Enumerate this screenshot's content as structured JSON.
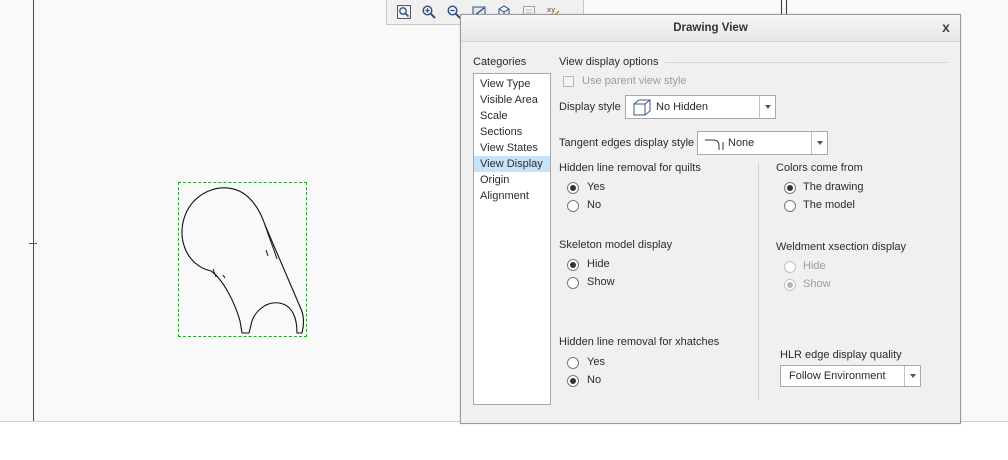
{
  "toolbar": {
    "icons": [
      "zoom-window-icon",
      "zoom-in-icon",
      "zoom-out-icon",
      "repaint-icon",
      "display-style-icon",
      "sheet-icon",
      "snap-icon"
    ]
  },
  "dialog": {
    "title": "Drawing View",
    "close_label": "x",
    "categories_label": "Categories",
    "categories": [
      {
        "label": "View Type",
        "selected": false
      },
      {
        "label": "Visible Area",
        "selected": false
      },
      {
        "label": "Scale",
        "selected": false
      },
      {
        "label": "Sections",
        "selected": false
      },
      {
        "label": "View States",
        "selected": false
      },
      {
        "label": "View Display",
        "selected": true
      },
      {
        "label": "Origin",
        "selected": false
      },
      {
        "label": "Alignment",
        "selected": false
      }
    ],
    "section_title": "View display options",
    "use_parent_label": "Use parent view style",
    "display_style_label": "Display style",
    "display_style_value": "No Hidden",
    "tangent_label": "Tangent edges display style",
    "tangent_value": "None",
    "hlr_quilts": {
      "label": "Hidden line removal for quilts",
      "yes": "Yes",
      "no": "No",
      "selected": "Yes"
    },
    "colors_from": {
      "label": "Colors come from",
      "drawing": "The drawing",
      "model": "The model",
      "selected": "The drawing"
    },
    "skeleton": {
      "label": "Skeleton model display",
      "hide": "Hide",
      "show": "Show",
      "selected": "Hide"
    },
    "weldment": {
      "label": "Weldment xsection display",
      "hide": "Hide",
      "show": "Show",
      "selected": "Show"
    },
    "hlr_xhatches": {
      "label": "Hidden line removal for xhatches",
      "yes": "Yes",
      "no": "No",
      "selected": "No"
    },
    "hlr_quality": {
      "label": "HLR edge display quality",
      "value": "Follow Environment"
    }
  }
}
